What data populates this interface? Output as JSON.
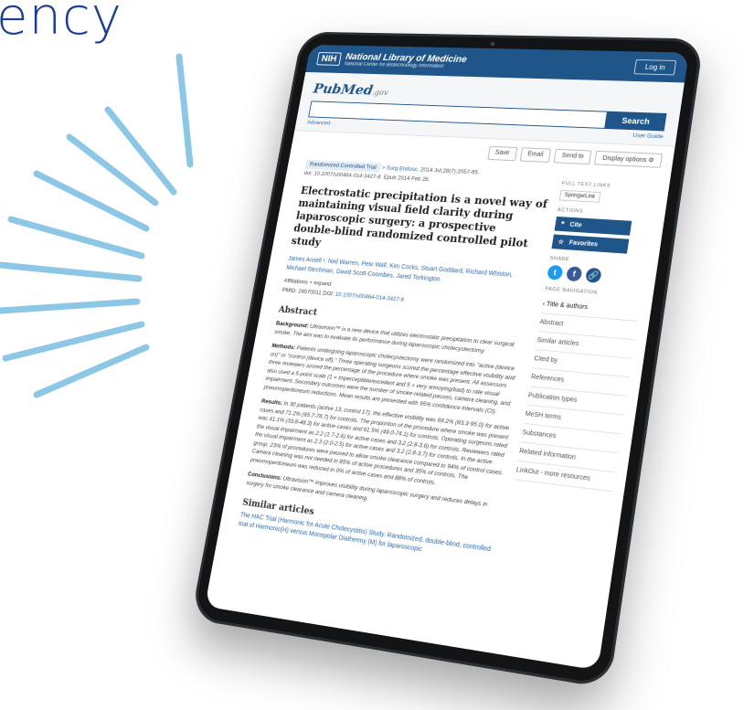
{
  "headline": {
    "text": "ency",
    "color": "#1c3f94"
  },
  "colors": {
    "ray": "#8cc7e6",
    "brand_blue": "#20558a",
    "link_blue": "#2b6cb0"
  },
  "header": {
    "logo_badge": "NIH",
    "title": "National Library of Medicine",
    "subtitle": "National Center for Biotechnology Information",
    "login_label": "Log in"
  },
  "search": {
    "logo": "PubMed",
    "logo_suffix": ".gov",
    "placeholder": "",
    "button_label": "Search",
    "advanced_label": "Advanced",
    "user_guide_label": "User Guide"
  },
  "toolbar": {
    "save": "Save",
    "email": "Email",
    "send_to": "Send to",
    "display_options": "Display options",
    "display_icon": "gear-icon"
  },
  "article": {
    "type_badge": "Randomized Controlled Trial",
    "journal": "> Surg Endosc.",
    "citation": "2014 Jul;28(7):2057-65.",
    "doi_line": "doi: 10.1007/s00464-014-3427-8. Epub 2014 Feb 26.",
    "title": "Electrostatic precipitation is a novel way of maintaining visual field clarity during laparoscopic surgery: a prospective double-blind randomized controlled pilot study",
    "authors": "James Ansell ¹, Neil Warren, Pete Wall, Kim Cocks, Stuart Goddard, Richard Whiston, Michael Stechman, David Scott-Coombes, Jared Torkington",
    "affiliations_label": "Affiliations",
    "expand_label": "+ expand",
    "pmid_label": "PMID: 24570011",
    "doi_label": "DOI:",
    "doi_link": "10.1007/s00464-014-3427-8"
  },
  "abstract": {
    "heading": "Abstract",
    "background_label": "Background:",
    "background": "Ultravision™ is a new device that utilizes electrostatic precipitation to clear surgical smoke. The aim was to evaluate its performance during laparoscopic cholecystectomy.",
    "methods_label": "Methods:",
    "methods": "Patients undergoing laparoscopic cholecystectomy were randomized into \"active (device on)\" or \"control (device off).\" Three operating surgeons scored the percentage effective visibility and three reviewers scored the percentage of the procedure where smoke was present. All assessors also used a 5-point scale (1 = imperceptible/excellent and 5 = very annoying/bad) to rate visual impairment. Secondary outcomes were the number of smoke-related pauses, camera cleaning, and pneumoperitoneum reductions. Mean results are presented with 95% confidence intervals (CI).",
    "results_label": "Results:",
    "results": "In 30 patients (active 13, control 17), the effective visibility was 69.2% (83.3-95.0) for active cases and 71.2% (65.7-76.7) for controls. The proportion of the procedure where smoke was present was 41.1% (33.8-48.3) for active cases and 61.5% (49.0-74.1) for controls. Operating surgeons rated the visual impairment as 2.2 (1.7-2.6) for active cases and 3.2 (2.8-3.6) for controls. Reviewers rated the visual impairment as 2.3 (2.0-2.5) for active cases and 3.2 (2.8-3.7) for controls. In the active group, 23% of procedures were paused to allow smoke clearance compared to 94% of control cases. Camera cleaning was not needed in 85% of active procedures and 35% of controls. The pneumoperitoneum was reduced in 0% of active cases and 88% of controls.",
    "conclusions_label": "Conclusions:",
    "conclusions": "Ultravision™ improves visibility during laparoscopic surgery and reduces delays in surgery for smoke clearance and camera cleaning."
  },
  "similar": {
    "heading": "Similar articles",
    "first_link": "The HAC Trial (Harmonic for Acute Cholecystitis) Study. Randomized, double-blind, controlled trial of Harmonic(H) versus Monopolar Diathermy (M) for laparoscopic"
  },
  "sidebar": {
    "full_text_label": "FULL TEXT LINKS",
    "springer_label": "SpringerLink",
    "actions_label": "ACTIONS",
    "cite_label": "Cite",
    "favorites_label": "Favorites",
    "share_label": "SHARE",
    "share_icons": [
      "twitter-icon",
      "facebook-icon",
      "link-icon"
    ],
    "page_nav_label": "PAGE NAVIGATION",
    "nav_items": [
      "Title & authors",
      "Abstract",
      "Similar articles",
      "Cited by",
      "References",
      "Publication types",
      "MeSH terms",
      "Substances",
      "Related information",
      "LinkOut - more resources"
    ]
  }
}
